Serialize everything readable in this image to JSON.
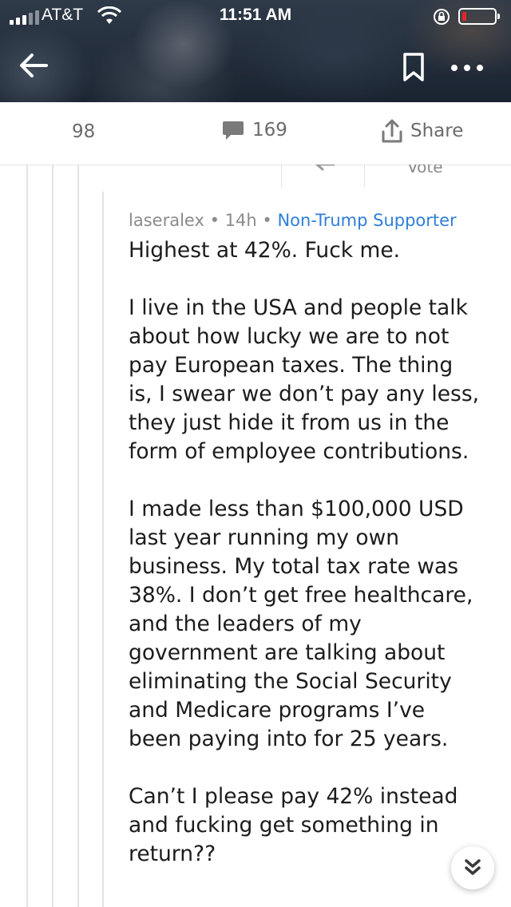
{
  "status_bar": {
    "carrier": "AT&T",
    "time": "11:51 AM",
    "battery_level": "low"
  },
  "header": {
    "back_icon": "arrow-left-icon",
    "bookmark_icon": "bookmark-icon",
    "more_icon": "ellipsis-icon"
  },
  "action_bar": {
    "votes": "98",
    "comments": "169",
    "share_label": "Share"
  },
  "previous_comment": {
    "vote_label": "Vote"
  },
  "comment": {
    "author": "laseralex",
    "separator": "•",
    "age": "14h",
    "flair": "Non-Trump Supporter",
    "paragraphs": [
      "Highest at 42%.  Fuck me.",
      "I live in the USA and people talk\nabout how lucky we are to not\npay European taxes.  The thing\nis, I swear we don’t pay any less,\nthey just hide it from us in the\nform of employee contributions.",
      "I made less than $100,000 USD\nlast year running my own\nbusiness.  My total tax rate was\n38%. I don’t get free healthcare,\nand the leaders of my\ngovernment are talking about\neliminating the Social Security\nand Medicare programs I’ve\nbeen paying into for 25 years.",
      "Can’t I please pay 42% instead\nand fucking get something in\nreturn??"
    ]
  },
  "colors": {
    "flair": "#2f7fd8",
    "meta": "#8b8b8b",
    "battery": "#e5252a"
  }
}
